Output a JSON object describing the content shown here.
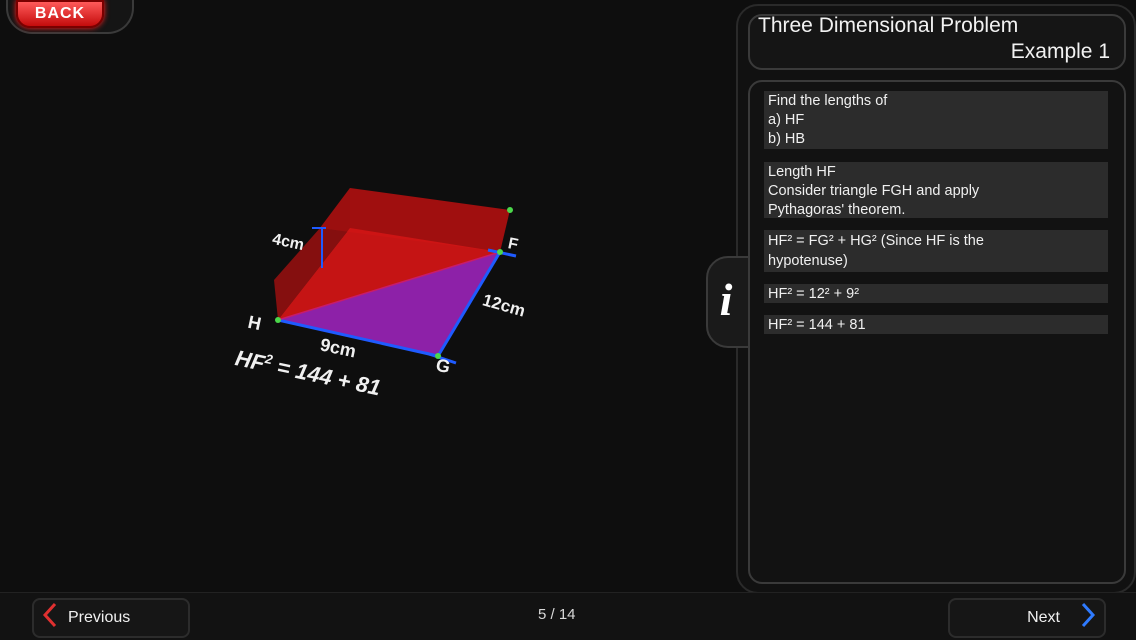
{
  "header": {
    "back_label": "BACK"
  },
  "panel": {
    "title_line1": "Three Dimensional Problem",
    "title_line2": "Example 1",
    "steps": [
      {
        "lines": [
          "Find the lengths of",
          "a) HF",
          "b) HB"
        ]
      },
      {
        "lines": [
          "Length HF",
          "Consider triangle FGH and apply",
          "Pythagoras' theorem."
        ]
      },
      {
        "lines": [
          "HF² = FG² + HG² (Since HF is the",
          "hypotenuse)"
        ]
      },
      {
        "lines": [
          "HF² = 12² + 9²"
        ]
      },
      {
        "lines": [
          "HF² = 144 + 81"
        ]
      }
    ],
    "info_icon": "i"
  },
  "scene": {
    "labels": {
      "h": "H",
      "f": "F",
      "g": "G",
      "height": "4cm",
      "length": "12cm",
      "width": "9cm"
    },
    "equation": {
      "lhs": "HF",
      "exp": "2",
      "rhs": "= 144 + 81"
    },
    "colors": {
      "box": "#d01515",
      "triangle": "#8a22b0",
      "edge": "#1f5bff",
      "point": "#4bd84b"
    }
  },
  "footer": {
    "previous_label": "Previous",
    "next_label": "Next",
    "page_indicator": "5 / 14",
    "prev_icon": "chevron-left-icon",
    "next_icon": "chevron-right-icon"
  }
}
